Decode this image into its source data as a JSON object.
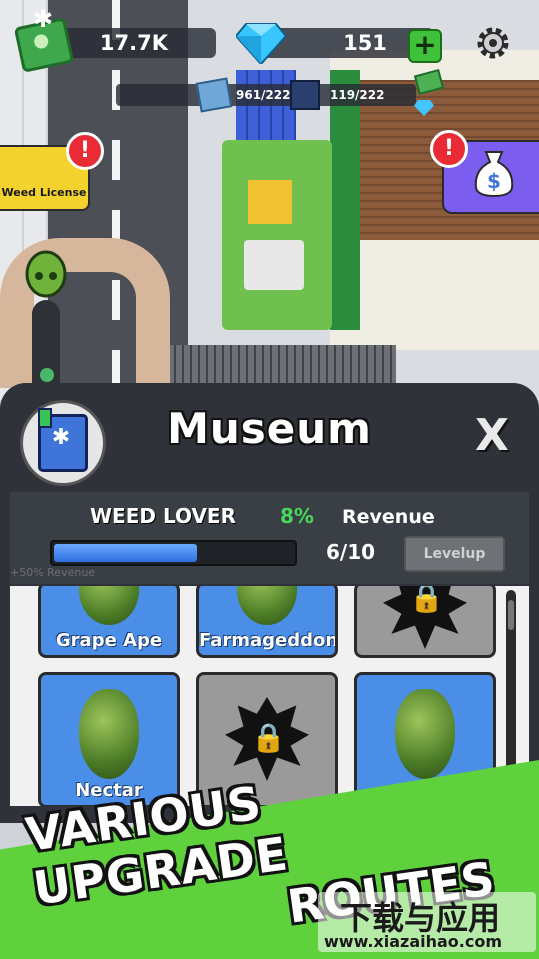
{
  "hud": {
    "cash": "17.7K",
    "gems": "151",
    "plus_label": "+",
    "resource_1": "961/222",
    "resource_2": "119/222"
  },
  "side_buttons": {
    "license_label": "Weed License",
    "alert_symbol": "!"
  },
  "museum": {
    "title": "Museum",
    "close_label": "X",
    "rank": "WEED LOVER",
    "percent": "8%",
    "revenue_label": "Revenue",
    "progress_fraction": 0.6,
    "count": "6/10",
    "levelup_label": "Levelup",
    "faint_text": "+50% Revenue"
  },
  "strains": [
    {
      "label": "Grape Ape",
      "locked": false
    },
    {
      "label": "Farmageddon",
      "locked": false
    },
    {
      "label": "",
      "locked": true
    },
    {
      "label": "Nectar",
      "locked": false
    },
    {
      "label": "",
      "locked": true
    },
    {
      "label": "",
      "locked": false
    }
  ],
  "banner": {
    "line1": "VARIOUS UPGRADE",
    "line2": "ROUTES"
  },
  "watermark": {
    "chinese": "下载与应用",
    "url": "www.xiazaihao.com"
  },
  "colors": {
    "accent_green": "#5ed13c",
    "panel_bg": "#2f3238",
    "card_blue": "#4a8ee8",
    "alert_red": "#e82b35"
  }
}
